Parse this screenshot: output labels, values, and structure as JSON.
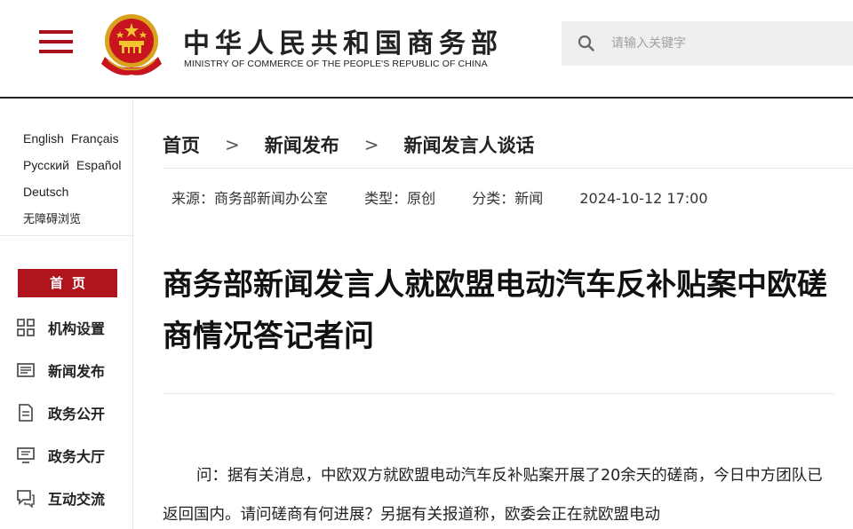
{
  "header": {
    "title": "中华人民共和国商务部",
    "subtitle": "MINISTRY OF COMMERCE OF THE PEOPLE'S REPUBLIC OF CHINA",
    "search_placeholder": "请输入关键字"
  },
  "sidebar": {
    "languages": [
      "English",
      "Français",
      "Русский",
      "Español",
      "Deutsch"
    ],
    "accessibility": "无障碍浏览",
    "home_label": "首页",
    "nav": [
      {
        "label": "机构设置",
        "icon": "grid-icon"
      },
      {
        "label": "新闻发布",
        "icon": "news-icon"
      },
      {
        "label": "政务公开",
        "icon": "document-icon"
      },
      {
        "label": "政务大厅",
        "icon": "monitor-icon"
      },
      {
        "label": "互动交流",
        "icon": "chat-icon"
      }
    ]
  },
  "breadcrumb": [
    "首页",
    "新闻发布",
    "新闻发言人谈话"
  ],
  "meta": {
    "source": "来源：商务部新闻办公室",
    "type": "类型：原创",
    "category": "分类：新闻",
    "datetime": "2024-10-12 17:00"
  },
  "article": {
    "title": "商务部新闻发言人就欧盟电动汽车反补贴案中欧磋商情况答记者问",
    "body": "问：据有关消息，中欧双方就欧盟电动汽车反补贴案开展了20余天的磋商，今日中方团队已返回国内。请问磋商有何进展？另据有关报道称，欧委会正在就欧盟电动"
  },
  "colors": {
    "brand_red": "#b0141d",
    "search_bg": "#efefef"
  }
}
